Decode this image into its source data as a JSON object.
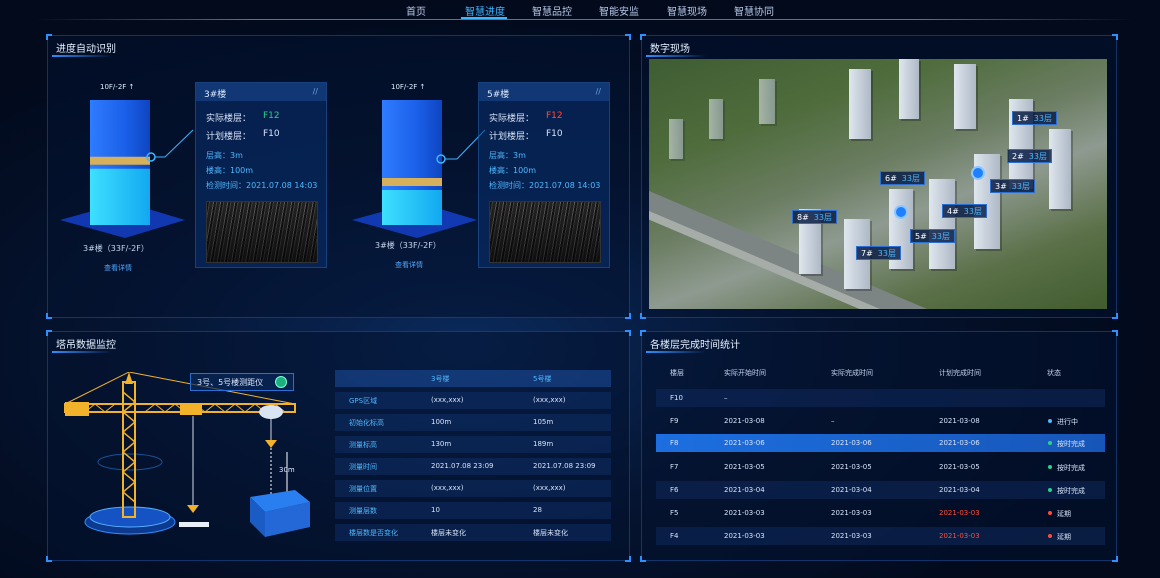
{
  "nav": {
    "items": [
      {
        "label": "首页",
        "active": false
      },
      {
        "label": "智慧进度",
        "active": true
      },
      {
        "label": "智慧品控",
        "active": false
      },
      {
        "label": "智能安监",
        "active": false
      },
      {
        "label": "智慧现场",
        "active": false
      },
      {
        "label": "智慧协同",
        "active": false
      }
    ]
  },
  "progress_panel": {
    "title": "进度自动识别",
    "buildings": [
      {
        "range_label": "10F/-2F ↑",
        "card_title": "3#楼",
        "actual_floor_label": "实际楼层：",
        "actual_floor": "F12",
        "actual_floor_color": "#2bd18a",
        "planned_floor_label": "计划楼层：",
        "planned_floor": "F10",
        "floor_height": "层高：3m",
        "building_height": "楼高：100m",
        "detect_time": "检测时间：2021.07.08  14:03",
        "bottom_label": "3#楼（33F/-2F）",
        "detail_link": "查看详情",
        "progress": 0.45
      },
      {
        "range_label": "10F/-2F ↑",
        "card_title": "5#楼",
        "actual_floor_label": "实际楼层：",
        "actual_floor": "F12",
        "actual_floor_color": "#ff4b3a",
        "planned_floor_label": "计划楼层：",
        "planned_floor": "F10",
        "floor_height": "层高：3m",
        "building_height": "楼高：100m",
        "detect_time": "检测时间：2021.07.08  14:03",
        "bottom_label": "3#楼（33F/-2F）",
        "detail_link": "查看详情",
        "progress": 0.28
      }
    ]
  },
  "digital_site": {
    "title": "数字现场",
    "tags": [
      {
        "name": "1#",
        "floors": "33层"
      },
      {
        "name": "2#",
        "floors": "33层"
      },
      {
        "name": "3#",
        "floors": "33层"
      },
      {
        "name": "4#",
        "floors": "33层"
      },
      {
        "name": "5#",
        "floors": "33层"
      },
      {
        "name": "6#",
        "floors": "33层"
      },
      {
        "name": "7#",
        "floors": "33层"
      },
      {
        "name": "8#",
        "floors": "33层"
      }
    ]
  },
  "crane_panel": {
    "title": "塔吊数据监控",
    "legend": "3号、5号楼测距仪",
    "distance": "30m",
    "table": {
      "headers": [
        "",
        "3号楼",
        "5号楼"
      ],
      "rows": [
        {
          "key": "GPS区域",
          "a": "(xxx,xxx)",
          "b": "(xxx,xxx)"
        },
        {
          "key": "初始化标高",
          "a": "100m",
          "b": "105m"
        },
        {
          "key": "测量标高",
          "a": "130m",
          "b": "189m"
        },
        {
          "key": "测量时间",
          "a": "2021.07.08  23:09",
          "b": "2021.07.08  23:09"
        },
        {
          "key": "测量位置",
          "a": "(xxx,xxx)",
          "b": "(xxx,xxx)"
        },
        {
          "key": "测量层数",
          "a": "10",
          "b": "28"
        },
        {
          "key": "楼层数是否变化",
          "a": "楼层未变化",
          "b": "楼层未变化"
        }
      ]
    }
  },
  "floor_stats": {
    "title": "各楼层完成时间统计",
    "headers": [
      "楼层",
      "实际开始时间",
      "实际完成时间",
      "计划完成时间",
      "状态"
    ],
    "rows": [
      {
        "floor": "F10",
        "start": "–",
        "end": "",
        "plan": "",
        "status": "",
        "status_color": "",
        "plan_red": false
      },
      {
        "floor": "F9",
        "start": "2021-03-08",
        "end": "–",
        "plan": "2021-03-08",
        "status": "进行中",
        "status_color": "#4fb8ff",
        "plan_red": false
      },
      {
        "floor": "F8",
        "start": "2021-03-06",
        "end": "2021-03-06",
        "plan": "2021-03-06",
        "status": "按时完成",
        "status_color": "#2bd18a",
        "plan_red": false
      },
      {
        "floor": "F7",
        "start": "2021-03-05",
        "end": "2021-03-05",
        "plan": "2021-03-05",
        "status": "按时完成",
        "status_color": "#2bd18a",
        "plan_red": false
      },
      {
        "floor": "F6",
        "start": "2021-03-04",
        "end": "2021-03-04",
        "plan": "2021-03-04",
        "status": "按时完成",
        "status_color": "#2bd18a",
        "plan_red": false
      },
      {
        "floor": "F5",
        "start": "2021-03-03",
        "end": "2021-03-03",
        "plan": "2021-03-03",
        "status": "延期",
        "status_color": "#ff4b3a",
        "plan_red": true
      },
      {
        "floor": "F4",
        "start": "2021-03-03",
        "end": "2021-03-03",
        "plan": "2021-03-03",
        "status": "延期",
        "status_color": "#ff4b3a",
        "plan_red": true
      }
    ],
    "highlight_index": 2
  }
}
